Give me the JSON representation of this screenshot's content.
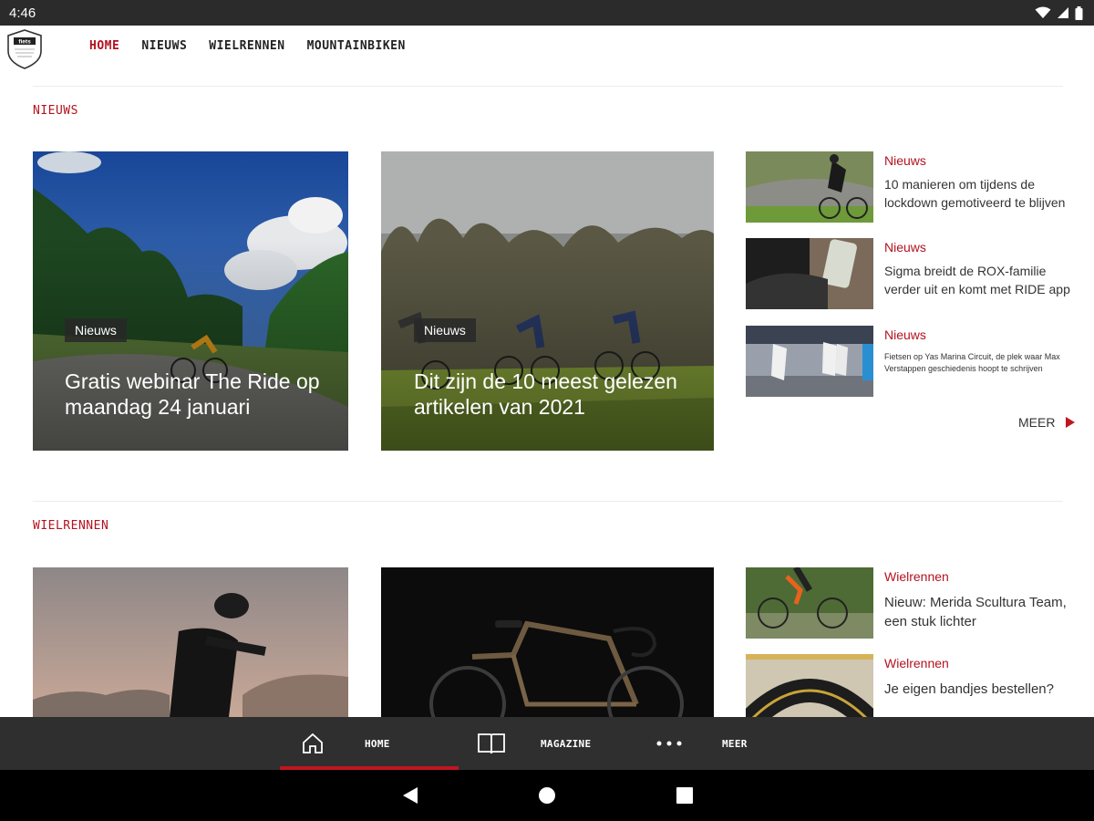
{
  "statusbar": {
    "time": "4:46"
  },
  "app": {
    "logo_text": "fiets"
  },
  "nav": {
    "items": [
      {
        "label": "HOME"
      },
      {
        "label": "NIEUWS"
      },
      {
        "label": "WIELRENNEN"
      },
      {
        "label": "MOUNTAINBIKEN"
      }
    ],
    "active_index": 0
  },
  "sections": {
    "nieuws": {
      "label": "NIEUWS",
      "featured": [
        {
          "badge": "Nieuws",
          "title": "Gratis webinar The Ride op maandag 24 januari"
        },
        {
          "badge": "Nieuws",
          "title": "Dit zijn de 10 meest gelezen artikelen van 2021"
        }
      ],
      "side": [
        {
          "category": "Nieuws",
          "title": "10 manieren om tijdens de lockdown gemotiveerd te blijven"
        },
        {
          "category": "Nieuws",
          "title": "Sigma breidt de ROX-familie verder uit en komt met RIDE app"
        },
        {
          "category": "Nieuws",
          "title": "Fietsen op Yas Marina Circuit, de plek waar Max Verstappen geschiedenis hoopt te schrijven"
        }
      ],
      "more_label": "MEER"
    },
    "wielrennen": {
      "label": "WIELRENNEN",
      "side": [
        {
          "category": "Wielrennen",
          "title": "Nieuw: Merida Scultura Team, een stuk lichter"
        },
        {
          "category": "Wielrennen",
          "title": "Je eigen bandjes bestellen?"
        }
      ]
    }
  },
  "bottom_tabs": [
    {
      "label": "HOME",
      "icon": "home-icon"
    },
    {
      "label": "MAGAZINE",
      "icon": "book-icon"
    },
    {
      "label": "MEER",
      "icon": "more-dots-icon"
    }
  ],
  "colors": {
    "accent": "#b3121f",
    "bottom_bar": "#2f2f2f",
    "status_bar": "#2b2b2b"
  }
}
